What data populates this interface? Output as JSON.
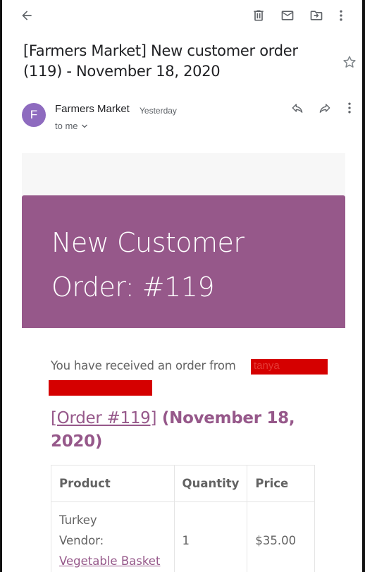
{
  "toolbar": {
    "back_icon": "arrow-back-icon",
    "delete_icon": "trash-icon",
    "mail_icon": "mark-unread-icon",
    "move_icon": "move-to-icon",
    "more_icon": "more-vert-icon"
  },
  "subject": "[Farmers Market] New customer order (119) - November 18, 2020",
  "sender": {
    "avatar_letter": "F",
    "avatar_color": "#8e6bbf",
    "name": "Farmers Market",
    "time": "Yesterday",
    "to": "to me"
  },
  "email": {
    "brand_color": "#96588a",
    "header_title": "New Customer Order: #119",
    "received_text": "You have received an order from",
    "redacted_name": "tanya",
    "order_link": "[Order #119]",
    "order_date": "(November 18, 2020)",
    "table": {
      "headers": [
        "Product",
        "Quantity",
        "Price"
      ],
      "rows": [
        {
          "product": "Turkey",
          "vendor_label": "Vendor:",
          "vendor_link": "Vegetable Basket",
          "quantity": "1",
          "price": "$35.00"
        }
      ]
    }
  }
}
